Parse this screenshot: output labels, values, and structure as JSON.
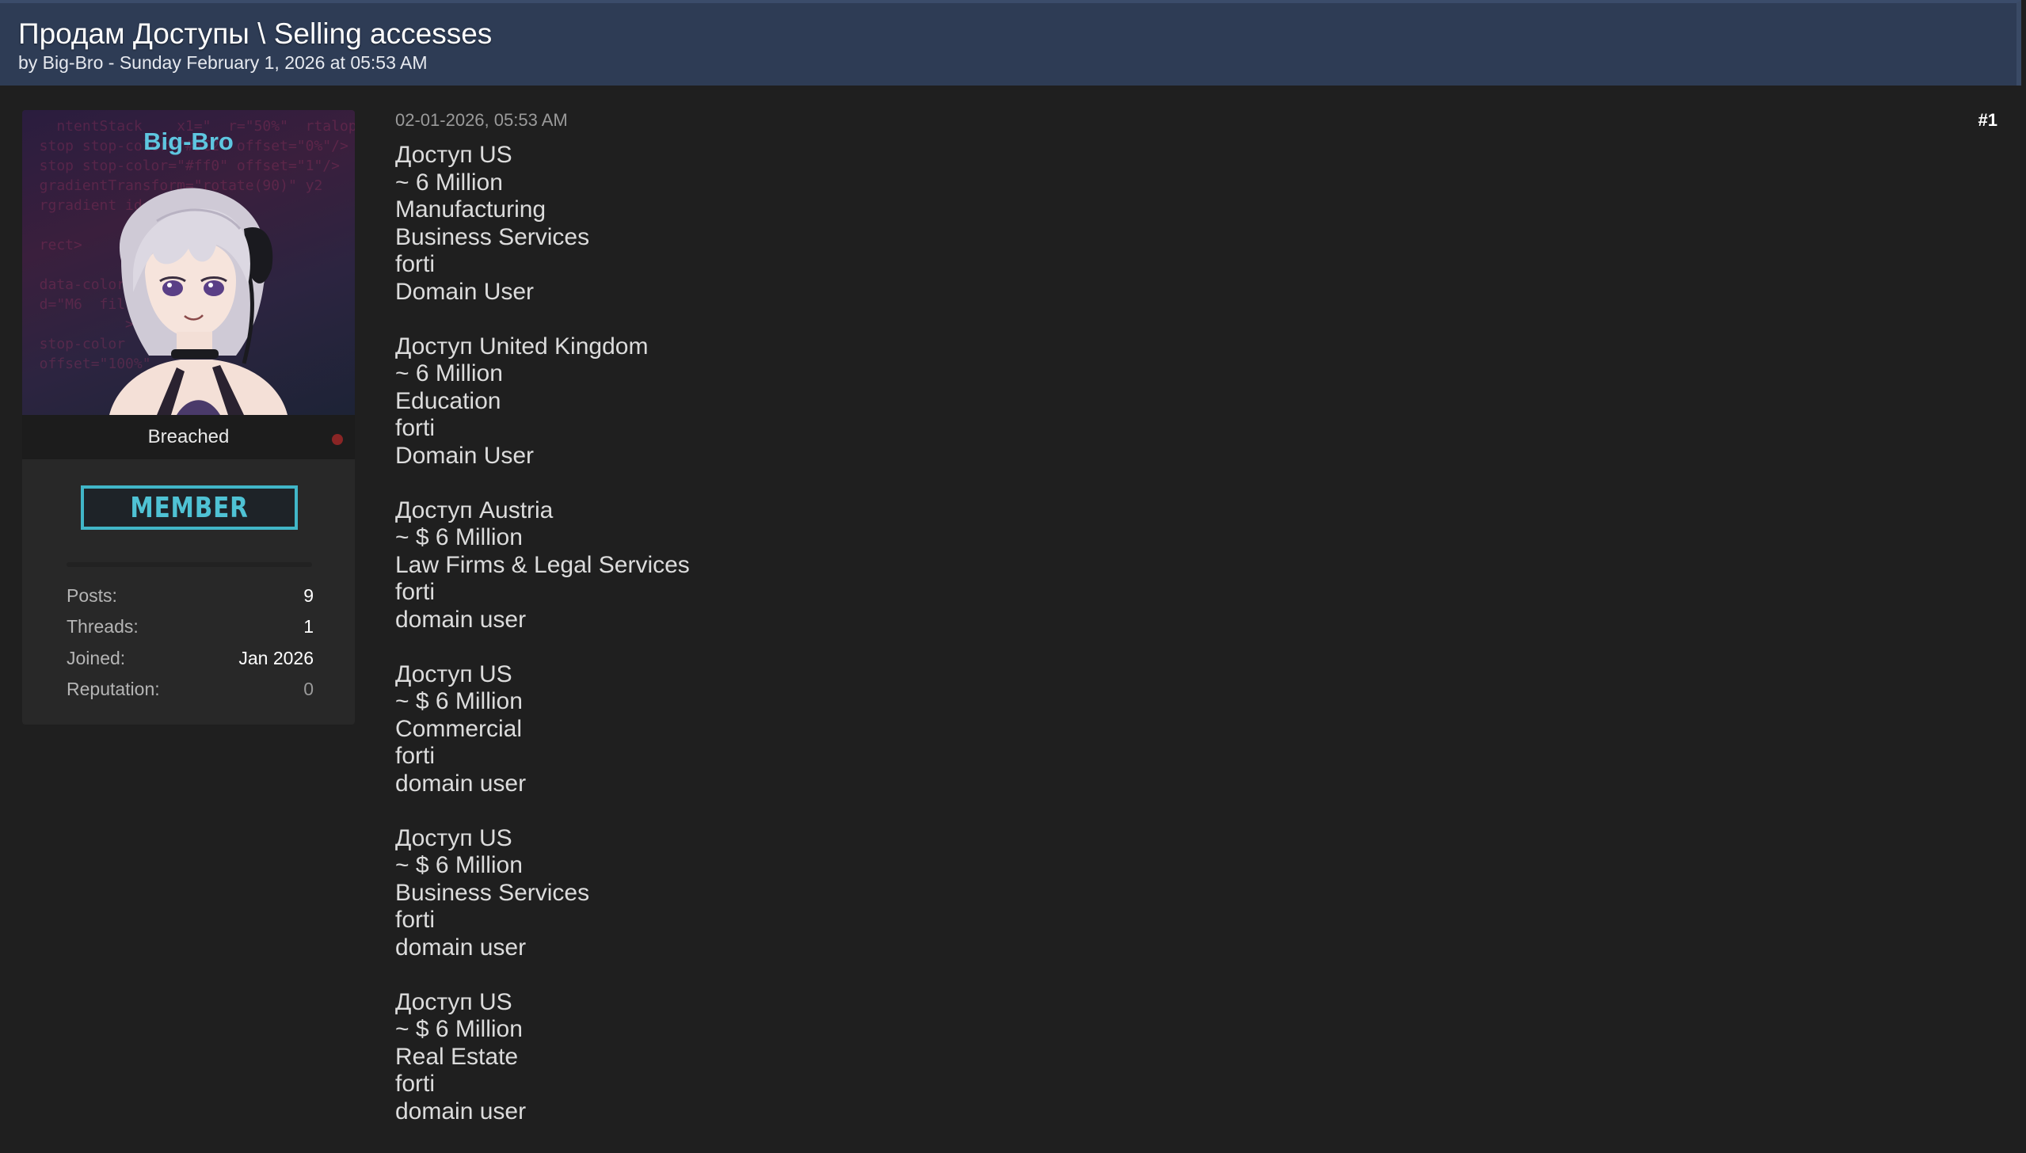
{
  "thread": {
    "title": "Продам Доступы \\ Selling accesses",
    "byline": "by Big-Bro - Sunday February 1, 2026 at 05:53 AM"
  },
  "user": {
    "username": "Big-Bro",
    "rank": "Breached",
    "badge": "MEMBER",
    "stats": [
      {
        "label": "Posts:",
        "value": "9"
      },
      {
        "label": "Threads:",
        "value": "1"
      },
      {
        "label": "Joined:",
        "value": "Jan 2026"
      },
      {
        "label": "Reputation:",
        "value": "0"
      }
    ]
  },
  "post": {
    "date": "02-01-2026, 05:53 AM",
    "number": "#1",
    "blocks": [
      [
        "Доступ US",
        "~ 6 Million",
        "Manufacturing",
        "Business Services",
        "forti",
        "Domain User"
      ],
      [
        "Доступ United Kingdom",
        "~ 6 Million",
        "Education",
        "forti",
        "Domain User"
      ],
      [
        "Доступ Austria",
        "~ $ 6 Million",
        "Law Firms & Legal Services",
        "forti",
        "domain user"
      ],
      [
        "Доступ US",
        "~ $ 6 Million",
        "Commercial",
        "forti",
        "domain user"
      ],
      [
        "Доступ US",
        "~ $ 6 Million",
        "Business Services",
        "forti",
        "domain user"
      ],
      [
        "Доступ US",
        "~ $ 6 Million",
        "Real Estate",
        "forti",
        "domain user"
      ]
    ]
  },
  "colors": {
    "header_bg": "#2e3c55",
    "page_bg": "#1f1f1f",
    "username": "#5ec6e0",
    "badge": "#41b6c8",
    "status_dot": "#8a2525"
  }
}
